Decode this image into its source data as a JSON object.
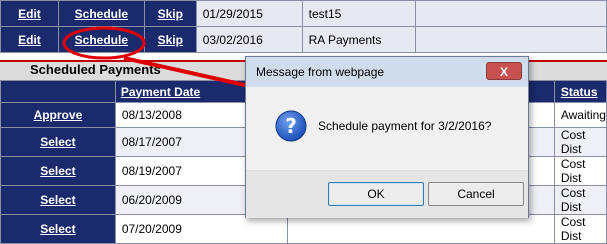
{
  "top_rows": [
    {
      "edit": "Edit",
      "schedule": "Schedule",
      "skip": "Skip",
      "date": "01/29/2015",
      "name": "test15"
    },
    {
      "edit": "Edit",
      "schedule": "Schedule",
      "skip": "Skip",
      "date": "03/02/2016",
      "name": "RA Payments"
    }
  ],
  "section_title": "Scheduled Payments",
  "sched_headers": {
    "date": "Payment Date",
    "status": "Status"
  },
  "sched_rows": [
    {
      "action": "Approve",
      "date": "08/13/2008",
      "status": "Awaiting"
    },
    {
      "action": "Select",
      "date": "08/17/2007",
      "status": "Cost Dist"
    },
    {
      "action": "Select",
      "date": "08/19/2007",
      "status": "Cost Dist"
    },
    {
      "action": "Select",
      "date": "06/20/2009",
      "status": "Cost Dist"
    },
    {
      "action": "Select",
      "date": "07/20/2009",
      "status": "Cost Dist"
    }
  ],
  "dialog": {
    "title": "Message from webpage",
    "close": "X",
    "icon": "question-icon",
    "message": "Schedule payment for 3/2/2016?",
    "ok": "OK",
    "cancel": "Cancel"
  },
  "annotation_color": "#e00000"
}
